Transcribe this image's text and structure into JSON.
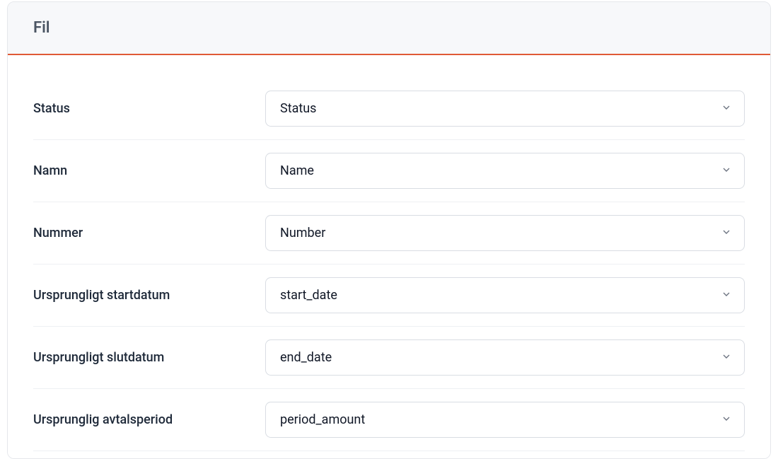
{
  "header": {
    "title": "Fil"
  },
  "fields": [
    {
      "label": "Status",
      "value": "Status"
    },
    {
      "label": "Namn",
      "value": "Name"
    },
    {
      "label": "Nummer",
      "value": "Number"
    },
    {
      "label": "Ursprungligt startdatum",
      "value": "start_date"
    },
    {
      "label": "Ursprungligt slutdatum",
      "value": "end_date"
    },
    {
      "label": "Ursprunglig avtalsperiod",
      "value": "period_amount"
    }
  ]
}
